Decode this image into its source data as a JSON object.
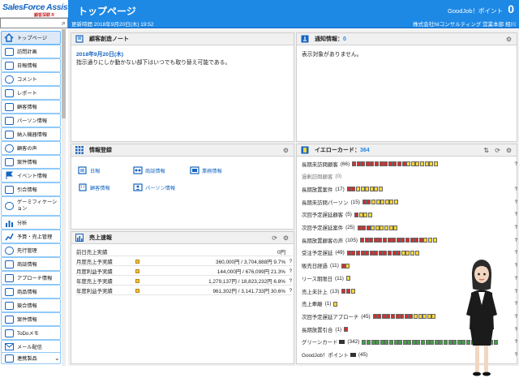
{
  "brand": {
    "name": "SalesForce Assistant",
    "sub": "顧客深耕 R"
  },
  "header": {
    "title": "トップページ",
    "updated": "更新時間 2018年9月20日(木) 19:52",
    "goodjob": "GoodJob！ポイント",
    "count": "0",
    "company": "株式会社NIコンサルティング 営業本部 相川"
  },
  "search": {
    "placeholder": ""
  },
  "sidebar": {
    "items": [
      {
        "label": "トップページ"
      },
      {
        "label": "訪問計画"
      },
      {
        "label": "日報情報"
      },
      {
        "label": "コメント"
      },
      {
        "label": "レポート"
      },
      {
        "label": "顧客情報"
      },
      {
        "label": "パーソン情報"
      },
      {
        "label": "納入機器情報"
      },
      {
        "label": "顧客の声"
      },
      {
        "label": "案件情報"
      },
      {
        "label": "イベント情報"
      },
      {
        "label": "引合情報"
      },
      {
        "label": "ゲーミフィケーション"
      },
      {
        "label": "分析"
      },
      {
        "label": "予算・売上管理"
      },
      {
        "label": "先行管理"
      },
      {
        "label": "商談情報"
      },
      {
        "label": "アプローチ情報"
      },
      {
        "label": "商品情報"
      },
      {
        "label": "競合情報"
      },
      {
        "label": "案件情報"
      },
      {
        "label": "ToDoメモ"
      },
      {
        "label": "メール配信"
      },
      {
        "label": "連携製品"
      }
    ]
  },
  "note": {
    "title": "顧客創造ノート",
    "date": "2018年9月20日(木)",
    "text": "指示通りにしか動かない部下はいつでも取り替え可能である。"
  },
  "notice": {
    "title": "通知情報",
    "count": "0",
    "empty": "表示対象がありません。"
  },
  "register": {
    "title": "情報登録",
    "items": [
      {
        "label": "日報"
      },
      {
        "label": "商談情報"
      },
      {
        "label": "業務情報"
      },
      {
        "label": "顧客情報"
      },
      {
        "label": "パーソン情報"
      }
    ]
  },
  "sales": {
    "title": "売上速報",
    "rows": [
      {
        "name": "前日売上実績",
        "value": "0円",
        "q": ""
      },
      {
        "name": "月度売上予実績",
        "value": "360,000円 / 3,704,888円 9.7%",
        "q": "?"
      },
      {
        "name": "月度利益予実績",
        "value": "144,000円 / 676,099円 21.3%",
        "q": "?"
      },
      {
        "name": "年度売上予実績",
        "value": "1,279,137円 / 18,823,232円 6.8%",
        "q": "?"
      },
      {
        "name": "年度利益予実績",
        "value": "961,302円 / 3,141,733円 30.6%",
        "q": "?"
      }
    ]
  },
  "yellowcard": {
    "title": "イエローカード",
    "count": "364",
    "rows": [
      {
        "label": "長期未訪問顧客",
        "count": "(66)",
        "bars": "RRRRRRRRRRRRYYYYYYY"
      },
      {
        "label": "過剰訪問顧客",
        "count": "(0)",
        "bars": ""
      },
      {
        "label": "長期放置案件",
        "count": "(17)",
        "bars": "RRYYYYYY"
      },
      {
        "label": "長期未訪問パーソン",
        "count": "(15)",
        "bars": "RRYYYYYY"
      },
      {
        "label": "次回予定遅延顧客",
        "count": "(5)",
        "bars": "RYYY"
      },
      {
        "label": "次回予定遅延案件",
        "count": "(25)",
        "bars": "RRRYYYYYY"
      },
      {
        "label": "長期放置顧客の声",
        "count": "(105)",
        "bars": "RRRRRRRRRRRRRRYYY"
      },
      {
        "label": "受注予定遅延",
        "count": "(49)",
        "bars": "RRRRRRRRRRRRYYYY"
      },
      {
        "label": "販売日経過",
        "count": "(11)",
        "bars": "RY"
      },
      {
        "label": "リース期限日",
        "count": "(11)",
        "bars": "Y"
      },
      {
        "label": "売上未計上",
        "count": "(13)",
        "bars": "RRY"
      },
      {
        "label": "売上牽離",
        "count": "(1)",
        "bars": "Y"
      },
      {
        "label": "次回予定遅延アプローチ",
        "count": "(45)",
        "bars": "RRRRRRRRRYYYYY"
      },
      {
        "label": "長期放置引合",
        "count": "(1)",
        "bars": "R"
      },
      {
        "label": "グリーンカード",
        "count": "(342)",
        "bars": "GGGGGGGGGGGGGGGGGGGGGGGGGGGGGG"
      },
      {
        "label": "GoodJob！ポイント",
        "count": "(45)",
        "bars": ""
      }
    ]
  }
}
